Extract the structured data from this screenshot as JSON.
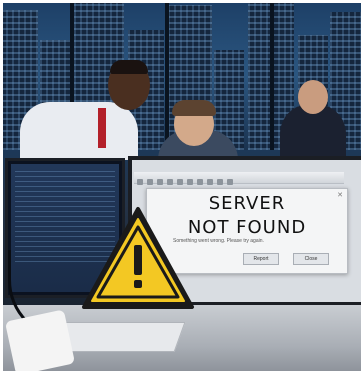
{
  "scene": {
    "description_tag": "office-error-photo"
  },
  "dialog": {
    "title_line1": "SERVER",
    "title_line2": "NOT FOUND",
    "message": "Something went wrong. Please try again.",
    "button_left": "Report",
    "button_right": "Close"
  },
  "colors": {
    "warning_yellow": "#f3c823",
    "warning_border": "#1a1a1a",
    "dialog_bg": "#f4f5f6"
  },
  "icons": {
    "warning": "warning-triangle-icon",
    "close": "close-icon"
  }
}
